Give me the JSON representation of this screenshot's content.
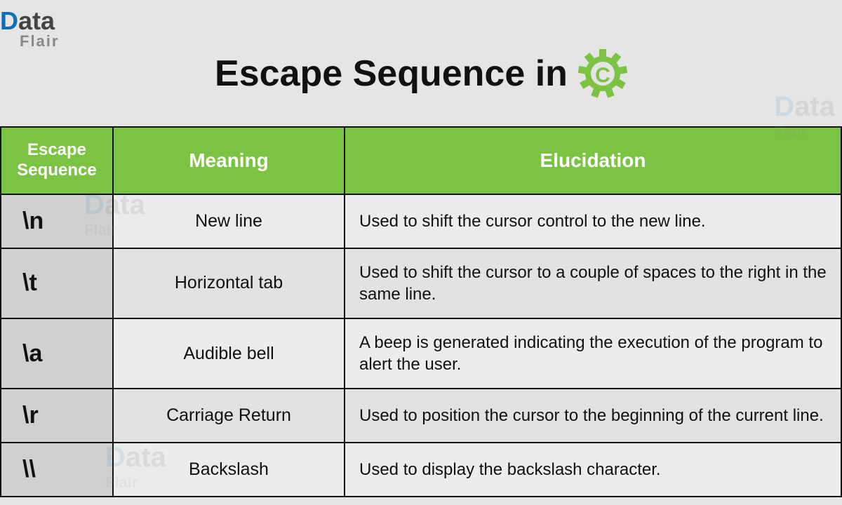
{
  "logo": {
    "brand_part1": "D",
    "brand_part2": "ata",
    "brand_sub": "Flair"
  },
  "title": "Escape Sequence in",
  "badge_letter": "C",
  "headers": {
    "col1": "Escape Sequence",
    "col2": "Meaning",
    "col3": "Elucidation"
  },
  "rows": [
    {
      "seq": "\\n",
      "meaning": "New line",
      "elucidation": "Used to shift the cursor control to the new line."
    },
    {
      "seq": "\\t",
      "meaning": "Horizontal tab",
      "elucidation": "Used to shift the cursor to a couple of spaces to the right in the same line."
    },
    {
      "seq": "\\a",
      "meaning": "Audible bell",
      "elucidation": "A beep is generated indicating the execution of the program to alert the user."
    },
    {
      "seq": "\\r",
      "meaning": "Carriage Return",
      "elucidation": "Used to position the cursor to the beginning of the current line."
    },
    {
      "seq": "\\\\",
      "meaning": "Backslash",
      "elucidation": "Used to display the backslash character."
    }
  ],
  "colors": {
    "header_bg": "#7cc243",
    "accent": "#0b70b8"
  }
}
